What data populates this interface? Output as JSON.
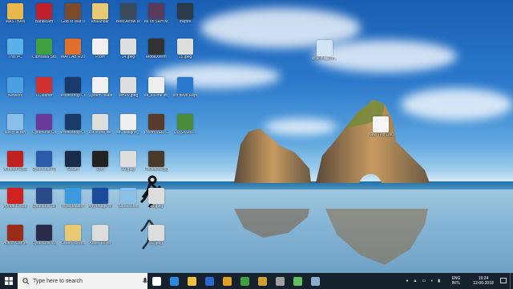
{
  "desktop": {
    "icons": [
      {
        "label": "MASTHAN",
        "color": "#e8b84a",
        "glyph": "folder-icon"
      },
      {
        "label": "Bandicam",
        "color": "#c0202a",
        "glyph": "bandicam-icon"
      },
      {
        "label": "God of War II",
        "color": "#7a4a2a",
        "glyph": "game-icon"
      },
      {
        "label": "khalandar",
        "color": "#e8c870",
        "glyph": "image-icon"
      },
      {
        "label": "Best Arrow scene E...",
        "color": "#3a4a5a",
        "glyph": "video-thumb-icon"
      },
      {
        "label": "MI vs SRH Match Hi...",
        "color": "#5a3a5a",
        "glyph": "video-thumb-icon"
      },
      {
        "label": "Inspire",
        "color": "#2a3a4a",
        "glyph": "movie-icon"
      },
      {
        "label": "This PC",
        "color": "#5ab0e8",
        "glyph": "pc-icon"
      },
      {
        "label": "Camtasia Studio 8",
        "color": "#3fa040",
        "glyph": "camtasia-icon"
      },
      {
        "label": "MATLAB R2017a",
        "color": "#e0702a",
        "glyph": "matlab-icon"
      },
      {
        "label": "Profit",
        "color": "#f0f0f0",
        "glyph": "document-icon"
      },
      {
        "label": "14.jpeg",
        "color": "#dddddd",
        "glyph": "image-icon"
      },
      {
        "label": "MobaXterm",
        "color": "#333333",
        "glyph": "terminal-icon"
      },
      {
        "label": "15.jpeg",
        "color": "#dddddd",
        "glyph": "image-icon"
      },
      {
        "label": "Network",
        "color": "#4aa0e0",
        "glyph": "network-icon"
      },
      {
        "label": "CCleaner",
        "color": "#d03030",
        "glyph": "ccleaner-icon"
      },
      {
        "label": "Photoshop CC.exe",
        "color": "#1a3a6a",
        "glyph": "photoshop-icon"
      },
      {
        "label": "System related",
        "color": "#f0f0f0",
        "glyph": "document-icon"
      },
      {
        "label": "MHPP.jpeg",
        "color": "#dddddd",
        "glyph": "image-icon"
      },
      {
        "label": "ek_kill-the lift_the uy...",
        "color": "#eeeeee",
        "glyph": "audio-icon"
      },
      {
        "label": "list deve Report",
        "color": "#2a7ad0",
        "glyph": "pdf-icon"
      },
      {
        "label": "Recycle Bin",
        "color": "#8ac0e8",
        "glyph": "recycle-bin-icon"
      },
      {
        "label": "CyberLink ColorDirect...",
        "color": "#6a3a9a",
        "glyph": "cyberlink-icon"
      },
      {
        "label": "Photoshop CC",
        "color": "#1a3a6a",
        "glyph": "photoshop-icon"
      },
      {
        "label": "list of the file",
        "color": "#dddddd",
        "glyph": "document-icon"
      },
      {
        "label": "Mr. designs_ welcome i...",
        "color": "#eeeeee",
        "glyph": "audio-icon"
      },
      {
        "label": "Pelon-VER-CIDriver...",
        "color": "#5a3a2a",
        "glyph": "video-thumb-icon"
      },
      {
        "label": "UD_20180...",
        "color": "#4a8a3a",
        "glyph": "video-thumb-icon"
      },
      {
        "label": "Acrobat Reader DC",
        "color": "#c02020",
        "glyph": "acrobat-icon"
      },
      {
        "label": "CyberLink PowerDVD...",
        "color": "#2a5aaa",
        "glyph": "powerdvd-icon"
      },
      {
        "label": "Steam",
        "color": "#1a2a4a",
        "glyph": "steam-icon"
      },
      {
        "label": "1pdf",
        "color": "#222222",
        "glyph": "document-icon"
      },
      {
        "label": "13.jpeg",
        "color": "#dddddd",
        "glyph": "image-icon"
      },
      {
        "label": "Pricedesk.jpg",
        "color": "#4a3a2a",
        "glyph": "image-icon"
      },
      {
        "label": "Adobe Creati...",
        "color": "#d02020",
        "glyph": "creative-cloud-icon"
      },
      {
        "label": "CyberLink Screen Re...",
        "color": "#2a4a8a",
        "glyph": "screen-recorder-icon"
      },
      {
        "label": "VideoMaster",
        "color": "#3a9ae0",
        "glyph": "play-icon"
      },
      {
        "label": "Any Image Manager",
        "color": "#1a4a9a",
        "glyph": "any-icon"
      },
      {
        "label": "Screenshot",
        "color": "#8ac0e8",
        "glyph": "screenshot-icon"
      },
      {
        "label": "10.jpeg",
        "color": "#dddddd",
        "glyph": "image-icon"
      },
      {
        "label": "Action Camera 2013",
        "color": "#9a2a1a",
        "glyph": "action-icon"
      },
      {
        "label": "CyberLink WaveEditor 2",
        "color": "#2a2a4a",
        "glyph": "wave-editor-icon"
      },
      {
        "label": "Green screen",
        "color": "#e8c870",
        "glyph": "folder-icon"
      },
      {
        "label": "AdbeFileVer",
        "color": "#dddddd",
        "glyph": "ae-icon"
      },
      {
        "label": "11.jpeg",
        "color": "#dddddd",
        "glyph": "image-icon"
      },
      {
        "label": "Bullshit_Dot...",
        "color": "#d0e4f4",
        "glyph": "document-icon"
      },
      {
        "label": "New Text Document",
        "color": "#f5f5f5",
        "glyph": "text-document-icon"
      }
    ]
  },
  "taskbar": {
    "search_placeholder": "Type here to search",
    "apps": [
      {
        "name": "mic-icon",
        "color": "#ffffff"
      },
      {
        "name": "task-view-icon",
        "color": "#ffffff"
      },
      {
        "name": "edge-icon",
        "color": "#2a8ae0"
      },
      {
        "name": "file-explorer-icon",
        "color": "#f0c040"
      },
      {
        "name": "store-icon",
        "color": "#2a6ad0"
      },
      {
        "name": "chrome-icon",
        "color": "#e0a020"
      },
      {
        "name": "app-green-icon",
        "color": "#40a040"
      },
      {
        "name": "app-yellow-icon",
        "color": "#d0a030"
      },
      {
        "name": "app-gear-icon",
        "color": "#a0a0a0"
      },
      {
        "name": "app-terminal-icon",
        "color": "#60c060"
      },
      {
        "name": "app-photo-icon",
        "color": "#8ab0d0"
      }
    ],
    "tray_icons": [
      "chrome-tray-icon",
      "people-icon",
      "network-icon",
      "volume-icon",
      "battery-icon",
      "wifi-icon"
    ],
    "language": {
      "top": "ENG",
      "bottom": "INTL"
    },
    "time": "19:24",
    "date": "12-06-2018"
  }
}
